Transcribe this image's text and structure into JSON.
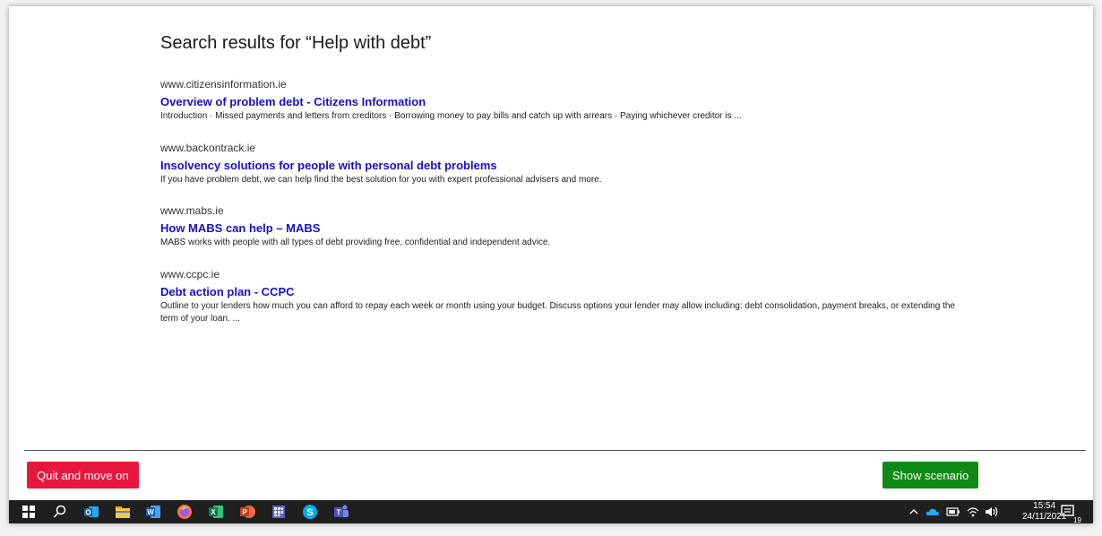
{
  "search": {
    "heading": "Search results for “Help with debt”",
    "results": [
      {
        "url": "www.citizensinformation.ie",
        "title": "Overview of problem debt - Citizens Information",
        "snippet": "Introduction · Missed payments and letters from creditors · Borrowing money to pay bills and catch up with arrears · Paying whichever creditor is ..."
      },
      {
        "url": "www.backontrack.ie",
        "title": "Insolvency solutions for people with personal debt problems",
        "snippet": "If you have problem debt, we can help find the best solution for you with expert professional advisers and more."
      },
      {
        "url": "www.mabs.ie",
        "title": "How MABS can help – MABS",
        "snippet": "MABS works with people with all types of debt providing free, confidential and independent advice."
      },
      {
        "url": "www.ccpc.ie",
        "title": "Debt action plan - CCPC",
        "snippet": "Outline to your lenders how much you can afford to repay each week or month using your budget. Discuss options your lender may allow including: debt consolidation, payment breaks, or extending the term of your loan. ..."
      }
    ]
  },
  "footer": {
    "quit_label": "Quit and move on",
    "scenario_label": "Show scenario"
  },
  "taskbar": {
    "time": "15:54",
    "date": "24/11/2021",
    "notification_count": "19",
    "apps": [
      "windows-start",
      "search",
      "outlook",
      "file-explorer",
      "word",
      "firefox",
      "excel",
      "powerpoint",
      "calculator",
      "skype",
      "teams"
    ]
  },
  "colors": {
    "link": "#1a0dcc",
    "quit": "#e8173f",
    "scenario": "#108a17",
    "taskbar": "#1f1f1f"
  }
}
